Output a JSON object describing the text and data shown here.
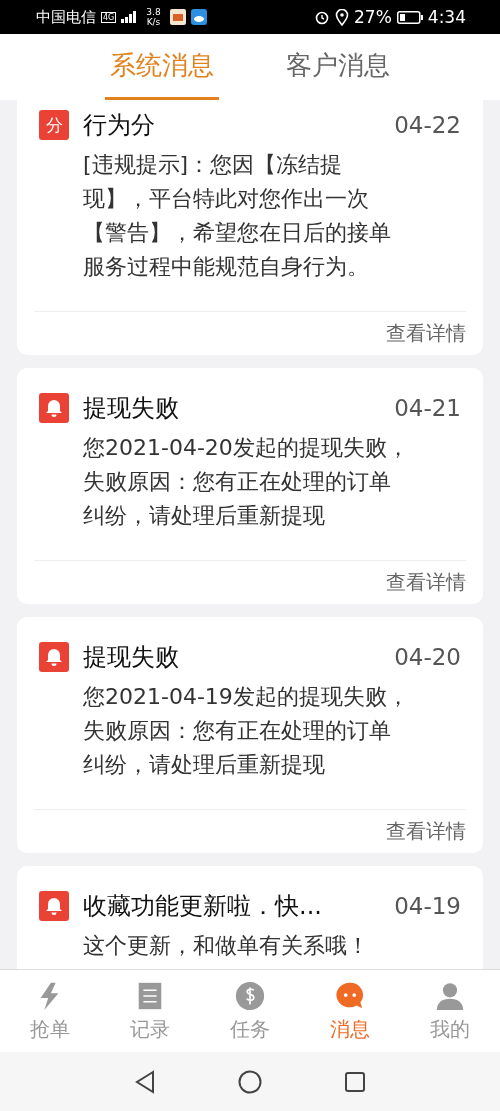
{
  "status_bar": {
    "carrier": "中国电信",
    "network": "4G",
    "speed": [
      "3.8",
      "K/s"
    ],
    "battery_text": "27%",
    "time": "4:34"
  },
  "tabs": [
    {
      "label": "系统消息",
      "selected": true
    },
    {
      "label": "客户消息",
      "selected": false
    }
  ],
  "messages": [
    {
      "icon": {
        "kind": "text",
        "label": "分"
      },
      "title": "行为分",
      "date": "04-22",
      "lines": [
        "[违规提示]：您因【冻结提",
        "现】，平台特此对您作出一次",
        "【警告】，希望您在日后的接单",
        "服务过程中能规范自身行为。"
      ],
      "link": "查看详情"
    },
    {
      "icon": {
        "kind": "bell"
      },
      "title": "提现失败",
      "date": "04-21",
      "lines": [
        "您2021-04-20发起的提现失败，",
        "失败原因：您有正在处理的订单",
        "纠纷，请处理后重新提现"
      ],
      "link": "查看详情"
    },
    {
      "icon": {
        "kind": "bell"
      },
      "title": "提现失败",
      "date": "04-20",
      "lines": [
        "您2021-04-19发起的提现失败，",
        "失败原因：您有正在处理的订单",
        "纠纷，请处理后重新提现"
      ],
      "link": "查看详情"
    },
    {
      "icon": {
        "kind": "bell"
      },
      "title": "收藏功能更新啦．快...",
      "date": "04-19",
      "lines": [
        "这个更新，和做单有关系哦！"
      ]
    }
  ],
  "bottom_nav": [
    {
      "label": "抢单",
      "kind": "bolt",
      "selected": false
    },
    {
      "label": "记录",
      "kind": "list",
      "selected": false
    },
    {
      "label": "任务",
      "kind": "dollar",
      "selected": false
    },
    {
      "label": "消息",
      "kind": "chat",
      "selected": true
    },
    {
      "label": "我的",
      "kind": "person",
      "selected": false
    }
  ]
}
